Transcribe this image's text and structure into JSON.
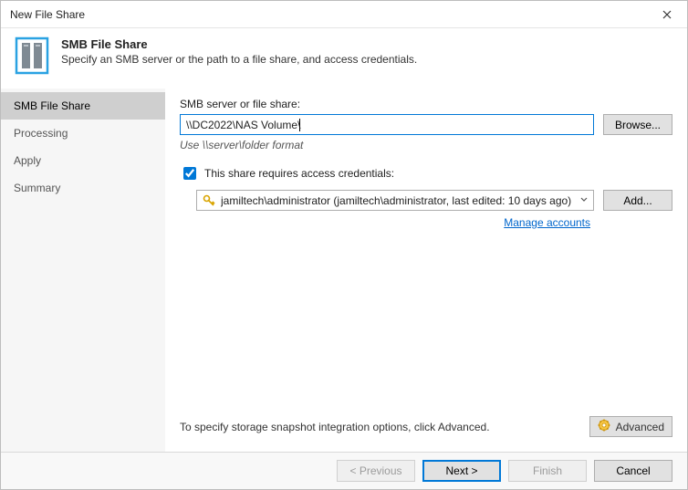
{
  "titlebar": {
    "title": "New File Share"
  },
  "header": {
    "title": "SMB File Share",
    "subtitle": "Specify an SMB server or the path to a file share, and access credentials."
  },
  "sidebar": {
    "items": [
      {
        "label": "SMB File Share",
        "active": true
      },
      {
        "label": "Processing",
        "active": false
      },
      {
        "label": "Apply",
        "active": false
      },
      {
        "label": "Summary",
        "active": false
      }
    ]
  },
  "main": {
    "server_label": "SMB server or file share:",
    "server_value": "\\\\DC2022\\NAS Volume\\",
    "browse_label": "Browse...",
    "format_hint": "Use \\\\server\\folder format",
    "checkbox_label": "This share requires access credentials:",
    "checkbox_checked": true,
    "credential_text": "jamiltech\\administrator (jamiltech\\administrator, last edited: 10 days ago)",
    "add_label": "Add...",
    "manage_link": "Manage accounts",
    "advanced_hint": "To specify storage snapshot integration options, click Advanced.",
    "advanced_label": "Advanced"
  },
  "footer": {
    "previous": "< Previous",
    "next": "Next >",
    "finish": "Finish",
    "cancel": "Cancel"
  },
  "icons": {
    "close": "close-icon",
    "file_share": "file-share-icon",
    "key": "key-icon",
    "chevron_down": "chevron-down-icon",
    "gear": "gear-icon"
  }
}
